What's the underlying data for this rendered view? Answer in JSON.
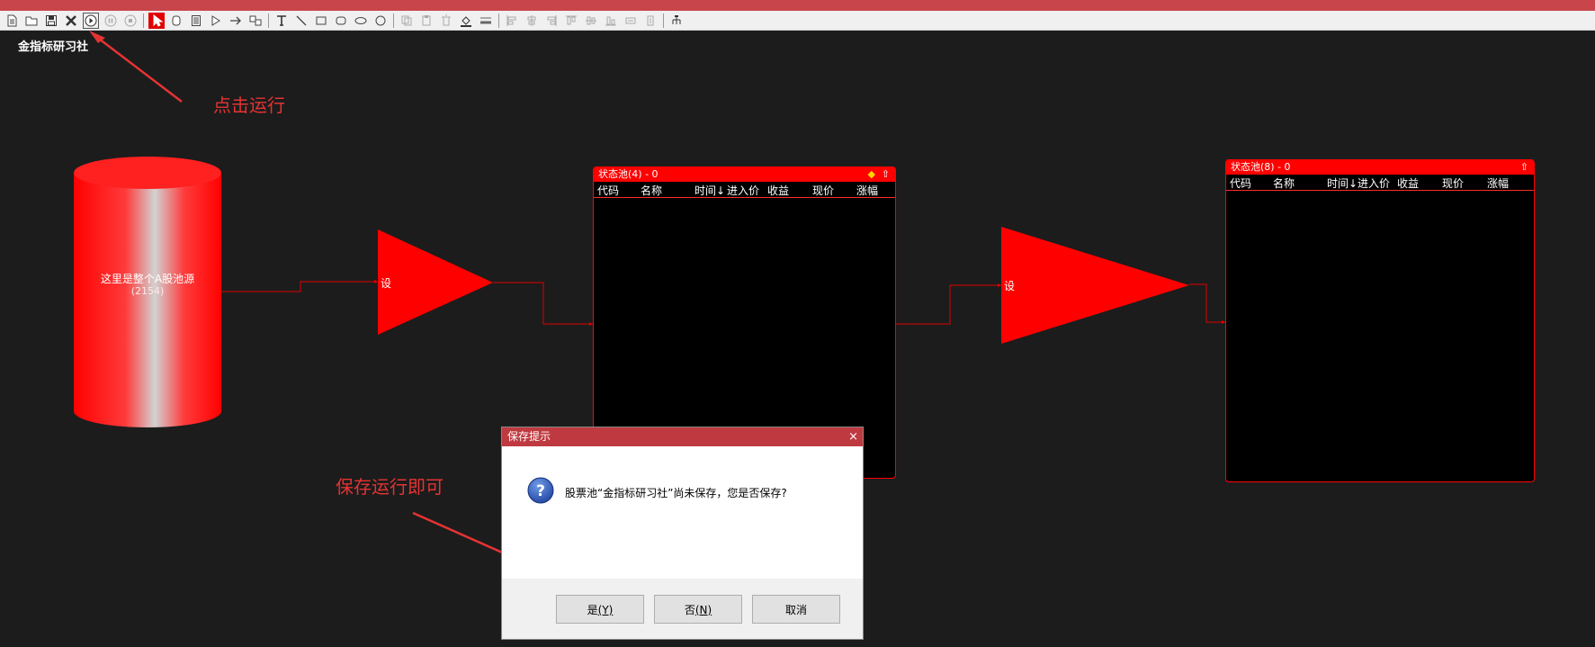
{
  "canvas": {
    "title": "金指标研习社"
  },
  "annotations": {
    "click_run": "点击运行",
    "save_run": "保存运行即可"
  },
  "source": {
    "label": "这里是整个A股池源",
    "count": "(2154)"
  },
  "filters": [
    {
      "label": "设"
    },
    {
      "label": "设"
    }
  ],
  "pools": [
    {
      "title": "状态池(4) - 0",
      "columns": [
        "代码",
        "名称",
        "时间↓",
        "进入价",
        "收益",
        "现价",
        "涨幅"
      ]
    },
    {
      "title": "状态池(8) - 0",
      "columns": [
        "代码",
        "名称",
        "时间↓",
        "进入价",
        "收益",
        "现价",
        "涨幅"
      ]
    }
  ],
  "dialog": {
    "title": "保存提示",
    "close": "×",
    "message": "股票池“金指标研习社”尚未保存，您是否保存?",
    "buttons": {
      "yes": "是",
      "yes_key": "(Y)",
      "no": "否",
      "no_key": "(N)",
      "cancel": "取消"
    }
  },
  "colors": {
    "accent": "#ff0000",
    "titlebar": "#c8464b",
    "annotation": "#e53333",
    "canvas_bg": "#1c1c1c"
  }
}
